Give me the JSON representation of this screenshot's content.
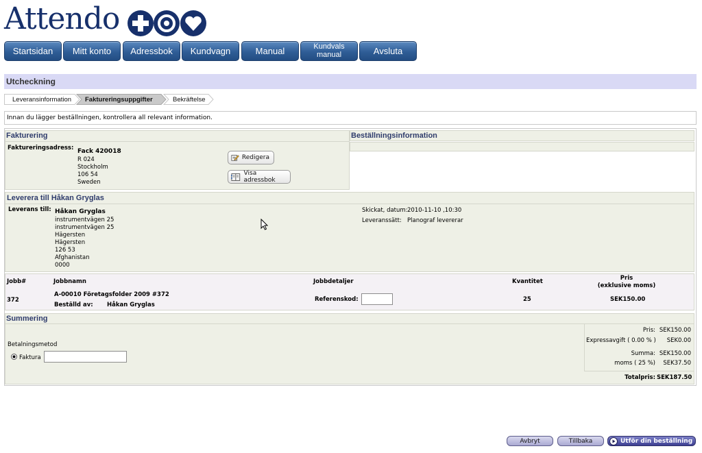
{
  "brand": {
    "name": "Attendo",
    "primary_color": "#17306b"
  },
  "nav": [
    {
      "label": "Startsidan"
    },
    {
      "label": "Mitt konto"
    },
    {
      "label": "Adressbok"
    },
    {
      "label": "Kundvagn"
    },
    {
      "label": "Manual"
    },
    {
      "label": "Kundvals\nmanual"
    },
    {
      "label": "Avsluta"
    }
  ],
  "page_title": "Utcheckning",
  "steps": [
    {
      "label": "Leveransinformation",
      "active": false
    },
    {
      "label": "Faktureringsuppgifter",
      "active": true
    },
    {
      "label": "Bekräftelse",
      "active": false
    }
  ],
  "instruction": "Innan du lägger beställningen, kontrollera all relevant information.",
  "billing": {
    "title": "Fakturering",
    "address_label": "Faktureringsadress:",
    "address_name": "Fack 420018",
    "address_lines": [
      "R 024",
      "Stockholm",
      "106 54",
      "Sweden"
    ],
    "edit_button": "Redigera",
    "addressbook_button": "Visa adressbok"
  },
  "order_info": {
    "title": "Beställningsinformation"
  },
  "delivery": {
    "title": "Leverera till Håkan Gryglas",
    "to_label": "Leverans till:",
    "name": "Håkan Gryglas",
    "lines": [
      "instrumentvägen 25",
      "instrumentvägen 25",
      "Hägersten",
      "Hägersten",
      "126 53",
      "Afghanistan",
      "0000"
    ],
    "sent_label": "Skickat, datum:",
    "sent_value": "2010-11-10 ,10:30",
    "method_label": "Leveranssätt:",
    "method_value": "Planograf levererar"
  },
  "jobs": {
    "headers": {
      "job_no": "Jobb#",
      "job_name": "Jobbnamn",
      "details": "Jobbdetaljer",
      "quantity": "Kvantitet",
      "price": "Pris",
      "price_sub": "(exklusive moms)"
    },
    "rows": [
      {
        "job_no": "372",
        "name": "A-00010 Företagsfolder 2009 #372",
        "ordered_by_label": "Beställd av:",
        "ordered_by": "Håkan Gryglas",
        "ref_label": "Referenskod:",
        "ref_value": "",
        "quantity": "25",
        "price": "SEK150.00"
      }
    ]
  },
  "summary": {
    "title": "Summering",
    "payment_label": "Betalningsmetod",
    "payment_option": "Faktura",
    "payment_value": "",
    "lines": [
      {
        "label": "Pris:",
        "value": "SEK150.00"
      },
      {
        "label": "Expressavgift ( 0.00 % )",
        "value": "SEK0.00"
      },
      {
        "label": "Summa:",
        "value": "SEK150.00"
      },
      {
        "label": "moms ( 25 %)",
        "value": "SEK37.50"
      }
    ],
    "total_label": "Totalpris:",
    "total_value": "SEK187.50"
  },
  "footer": {
    "cancel": "Avbryt",
    "back": "Tillbaka",
    "submit": "Utför din beställning"
  }
}
